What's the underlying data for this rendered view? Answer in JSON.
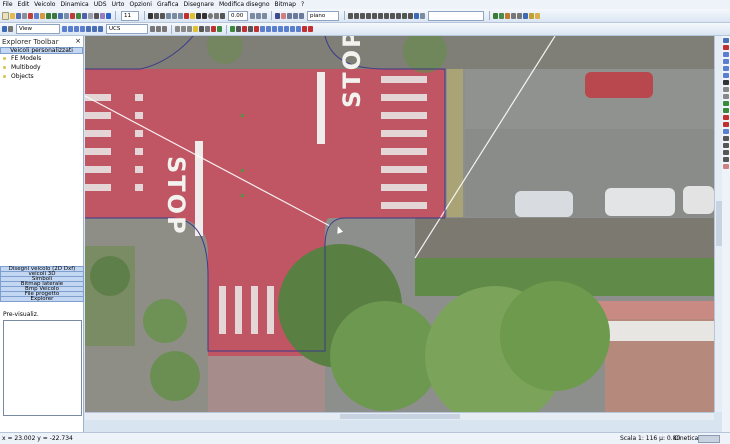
{
  "menu": [
    "File",
    "Edit",
    "Veicolo",
    "Dinamica",
    "UDS",
    "Urto",
    "Opzioni",
    "Grafica",
    "Disegnare",
    "Modifica disegno",
    "Bitmap",
    "?"
  ],
  "toolbar": {
    "line_width": "11",
    "value_field": "0.00",
    "layer": "piano",
    "view_label": "View",
    "ucs_label": "UCS"
  },
  "sidebar": {
    "title": "Explorer Toolbar",
    "close_label": "×",
    "header": "Veicoli personalizzati",
    "tree": [
      "FE Models",
      "Multibody",
      "Objects"
    ],
    "tabs": [
      "Disegni veicolo (2D Dxf)",
      "veicoli 3D",
      "Simboli",
      "Bitmap laterale",
      "Bmp Veicolo",
      "File progetto",
      "Explorer"
    ],
    "preview_label": "Pre-visualiz."
  },
  "canvas": {
    "stop_text_1": "STOP",
    "stop_text_2": "STOP"
  },
  "status": {
    "coords": "x = 23.002 y = -22.734",
    "scale": "Scala 1: 116 μ: 0.80",
    "mode": "Cinetica"
  },
  "colors": {
    "road_red": "#c05563",
    "asphalt": "#8d8f8c",
    "vegetation": "#5c8046",
    "panel": "#c3d7f2",
    "path_line": "#3a3a8a"
  }
}
